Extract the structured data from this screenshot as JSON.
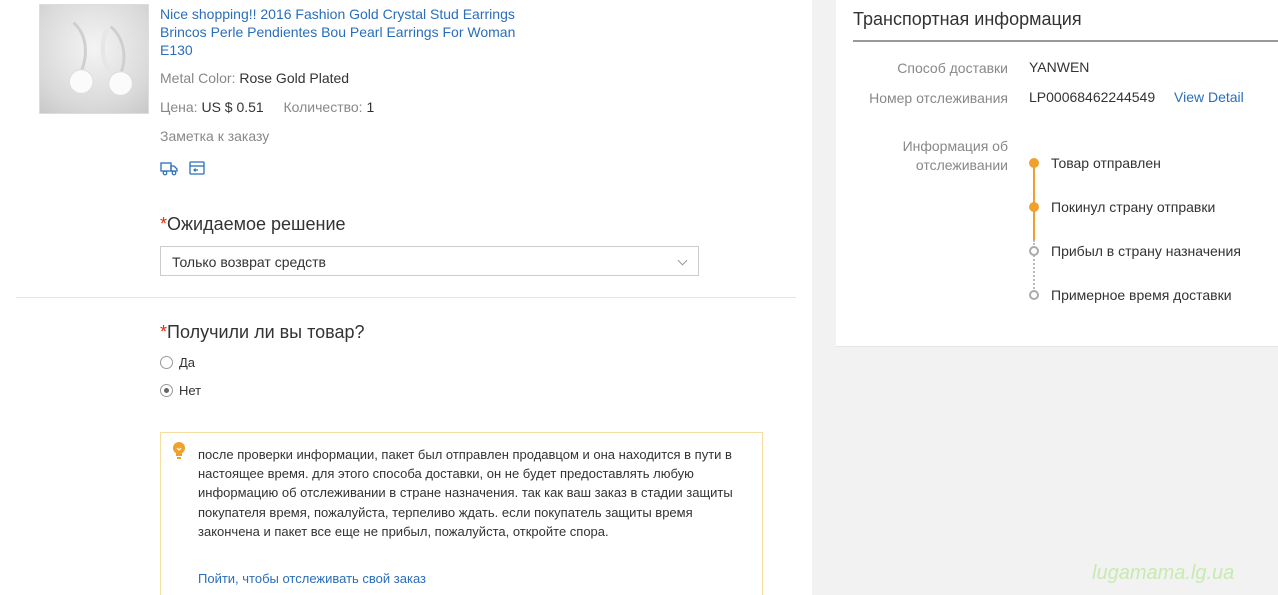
{
  "product": {
    "title": "Nice shopping!! 2016 Fashion Gold Crystal Stud Earrings Brincos Perle Pendientes Bou Pearl Earrings For Woman E130",
    "metal_color_label": "Metal Color:",
    "metal_color_value": "Rose Gold Plated",
    "price_label": "Цена:",
    "price_value": "US $ 0.51",
    "quantity_label": "Количество:",
    "quantity_value": "1",
    "note_link": "Заметка к заказу",
    "icons": [
      "truck-icon",
      "card-icon"
    ]
  },
  "resolution": {
    "required_mark": "*",
    "label": "Ожидаемое решение",
    "selected": "Только возврат средств"
  },
  "received": {
    "required_mark": "*",
    "label": "Получили ли вы товар?",
    "options": [
      {
        "label": "Да",
        "checked": false
      },
      {
        "label": "Нет",
        "checked": true
      }
    ]
  },
  "notice": {
    "text": "после проверки информации, пакет был отправлен продавцом и она находится в пути в настоящее время. для этого способа доставки, он не будет предоставлять любую информацию об отслеживании в стране назначения. так как ваш заказ в стадии защиты покупателя время, пожалуйста, терпеливо ждать. если покупатель защиты время закончена и пакет все еще не прибыл, пожалуйста, откройте спора.",
    "link": "Пойти, чтобы отслеживать свой заказ",
    "accent_color": "#f0a02c"
  },
  "shipping": {
    "title": "Транспортная информация",
    "method_label": "Способ доставки",
    "method_value": "YANWEN",
    "number_label": "Номер отслеживания",
    "number_value": "LP00068462244549",
    "view_detail": "View Detail",
    "tracking_label": "Информация об отслеживании",
    "steps": [
      {
        "label": "Товар отправлен",
        "done": true
      },
      {
        "label": "Покинул страну отправки",
        "done": true
      },
      {
        "label": "Прибыл в страну назначения",
        "done": false
      },
      {
        "label": "Примерное время доставки",
        "done": false
      }
    ]
  },
  "watermark": "lugamama.lg.ua"
}
